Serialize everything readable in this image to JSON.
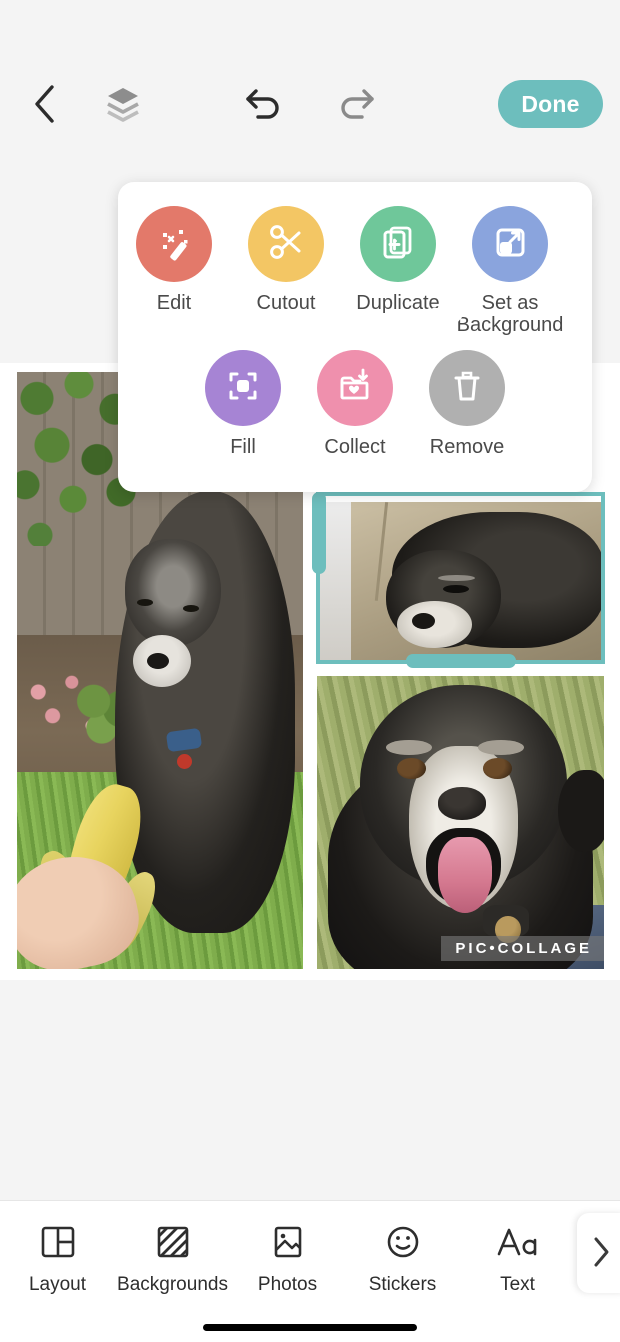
{
  "app": {
    "watermark": "PIC•COLLAGE",
    "accent_teal": "#6dbebd",
    "canvas_background": "#ffffff",
    "app_background": "#f4f4f4"
  },
  "top_toolbar": {
    "back_icon": "chevron-left-icon",
    "layers_icon": "layers-icon",
    "undo_icon": "undo-arrow-icon",
    "redo_icon": "redo-arrow-icon",
    "done_label": "Done"
  },
  "popup_menu": {
    "actions": [
      {
        "label": "Edit",
        "icon": "magic-wand-icon",
        "color": "#e3796a"
      },
      {
        "label": "Cutout",
        "icon": "scissors-icon",
        "color": "#f3c664"
      },
      {
        "label": "Duplicate",
        "icon": "duplicate-plus-icon",
        "color": "#6fc79a"
      },
      {
        "label": "Set as\nBackground",
        "icon": "expand-arrow-icon",
        "color": "#8aa4dd"
      },
      {
        "label": "Fill",
        "icon": "fit-to-frame-icon",
        "color": "#a684d4"
      },
      {
        "label": "Collect",
        "icon": "collect-heart-icon",
        "color": "#ef90ad"
      },
      {
        "label": "Remove",
        "icon": "trash-icon",
        "color": "#b0b0b0"
      }
    ],
    "set_as_background_line1": "Set as",
    "set_as_background_line2": "Background"
  },
  "collage": {
    "photos": [
      {
        "name": "dog-eating-banana",
        "selected": false
      },
      {
        "name": "dog-resting-couch",
        "selected": true
      },
      {
        "name": "dog-smiling-grass",
        "selected": false
      }
    ]
  },
  "bottom_toolbar": {
    "tools": [
      {
        "label": "Layout",
        "icon": "layout-grid-icon"
      },
      {
        "label": "Backgrounds",
        "icon": "pattern-swatch-icon"
      },
      {
        "label": "Photos",
        "icon": "photo-image-icon"
      },
      {
        "label": "Stickers",
        "icon": "smiley-face-icon"
      },
      {
        "label": "Text",
        "icon": "text-aa-icon"
      }
    ],
    "more_icon": "chevron-right-icon"
  }
}
